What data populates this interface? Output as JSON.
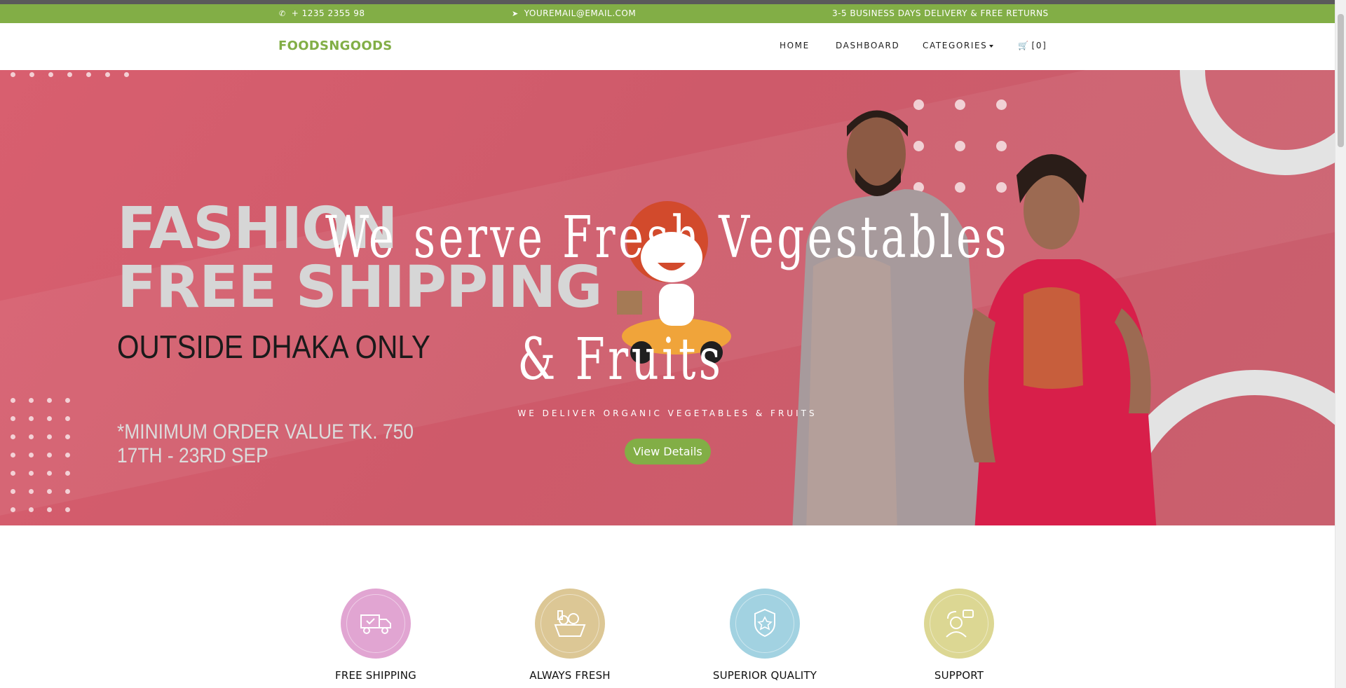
{
  "topbar": {
    "phone": "+ 1235 2355 98",
    "email": "YOUREMAIL@EMAIL.COM",
    "delivery": "3-5 BUSINESS DAYS DELIVERY & FREE RETURNS",
    "icons": {
      "phone": "phone-icon",
      "email": "paper-plane-icon"
    }
  },
  "nav": {
    "brand": "FOODSNGOODS",
    "links": [
      "HOME",
      "DASHBOARD",
      "CATEGORIES"
    ],
    "cart": "[0]"
  },
  "hero": {
    "headline_line1": "We serve Fresh Vegestables",
    "headline_line2": "& Fruits",
    "subheading": "WE DELIVER ORGANIC VEGETABLES & FRUITS",
    "cta": "View Details",
    "banner": {
      "line1": "FASHION",
      "line2": "FREE SHIPPING",
      "line3": "OUTSIDE DHAKA ONLY",
      "line4": "*MINIMUM ORDER VALUE TK. 750",
      "line5": "17TH - 23RD SEP"
    }
  },
  "features": [
    {
      "label": "FREE SHIPPING",
      "icon": "delivery-truck-icon",
      "color": "#e1a5d2"
    },
    {
      "label": "ALWAYS FRESH",
      "icon": "grocery-basket-icon",
      "color": "#dcc795"
    },
    {
      "label": "SUPERIOR QUALITY",
      "icon": "award-badge-icon",
      "color": "#a2d2e1"
    },
    {
      "label": "SUPPORT",
      "icon": "customer-support-icon",
      "color": "#dcd793"
    }
  ],
  "colors": {
    "accent": "#82ae46",
    "hero_bg": "#d25f6d"
  }
}
